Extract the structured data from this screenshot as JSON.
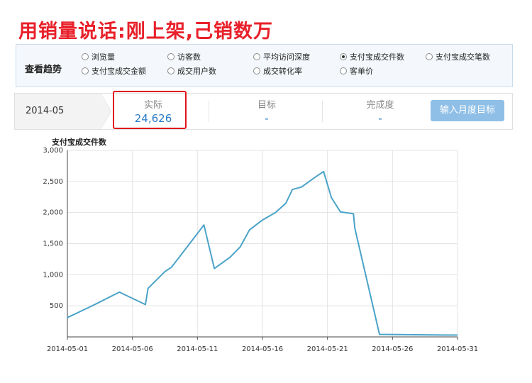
{
  "headline": "用销量说话:刚上架,己销数万",
  "trend": {
    "label": "查看趋势",
    "options": [
      {
        "label": "浏览量",
        "checked": false
      },
      {
        "label": "访客数",
        "checked": false
      },
      {
        "label": "平均访问深度",
        "checked": false
      },
      {
        "label": "支付宝成交件数",
        "checked": true
      },
      {
        "label": "支付宝成交笔数",
        "checked": false
      },
      {
        "label": "支付宝成交金额",
        "checked": false
      },
      {
        "label": "成交用户数",
        "checked": false
      },
      {
        "label": "成交转化率",
        "checked": false
      },
      {
        "label": "客单价",
        "checked": false
      }
    ]
  },
  "summary": {
    "date": "2014-05",
    "actual_label": "实际",
    "actual_value": "24,626",
    "target_label": "目标",
    "target_value": "-",
    "completion_label": "完成度",
    "completion_value": "-",
    "button_label": "输入月度目标"
  },
  "colors": {
    "line": "#4aa3c8",
    "highlight": "#e0151b",
    "headline": "#e8202a",
    "button": "#8fbfe6"
  },
  "chart_data": {
    "type": "line",
    "title": "支付宝成交件数",
    "xlabel": "",
    "ylabel": "",
    "ylim": [
      0,
      3000
    ],
    "yticks": [
      500,
      1000,
      1500,
      2000,
      2500,
      3000
    ],
    "ytick_labels": [
      "500",
      "1,000",
      "1,500",
      "2,000",
      "2,500",
      "3,000"
    ],
    "xtick_labels": [
      "2014-05-01",
      "2014-05-06",
      "2014-05-11",
      "2014-05-16",
      "2014-05-21",
      "2014-05-26",
      "2014-05-31"
    ],
    "grid": true,
    "x": [
      1,
      3,
      5,
      7,
      7.2,
      8.5,
      9,
      10,
      11.5,
      12.3,
      13.5,
      14.3,
      15,
      16,
      17,
      17.8,
      18.3,
      19,
      20,
      20.7,
      21.3,
      22,
      23,
      23.1,
      25,
      30,
      31
    ],
    "y": [
      310,
      510,
      720,
      520,
      780,
      1050,
      1120,
      1390,
      1800,
      1100,
      1280,
      1450,
      1720,
      1880,
      2000,
      2150,
      2370,
      2410,
      2560,
      2660,
      2240,
      2010,
      1980,
      1750,
      40,
      30,
      30
    ]
  }
}
